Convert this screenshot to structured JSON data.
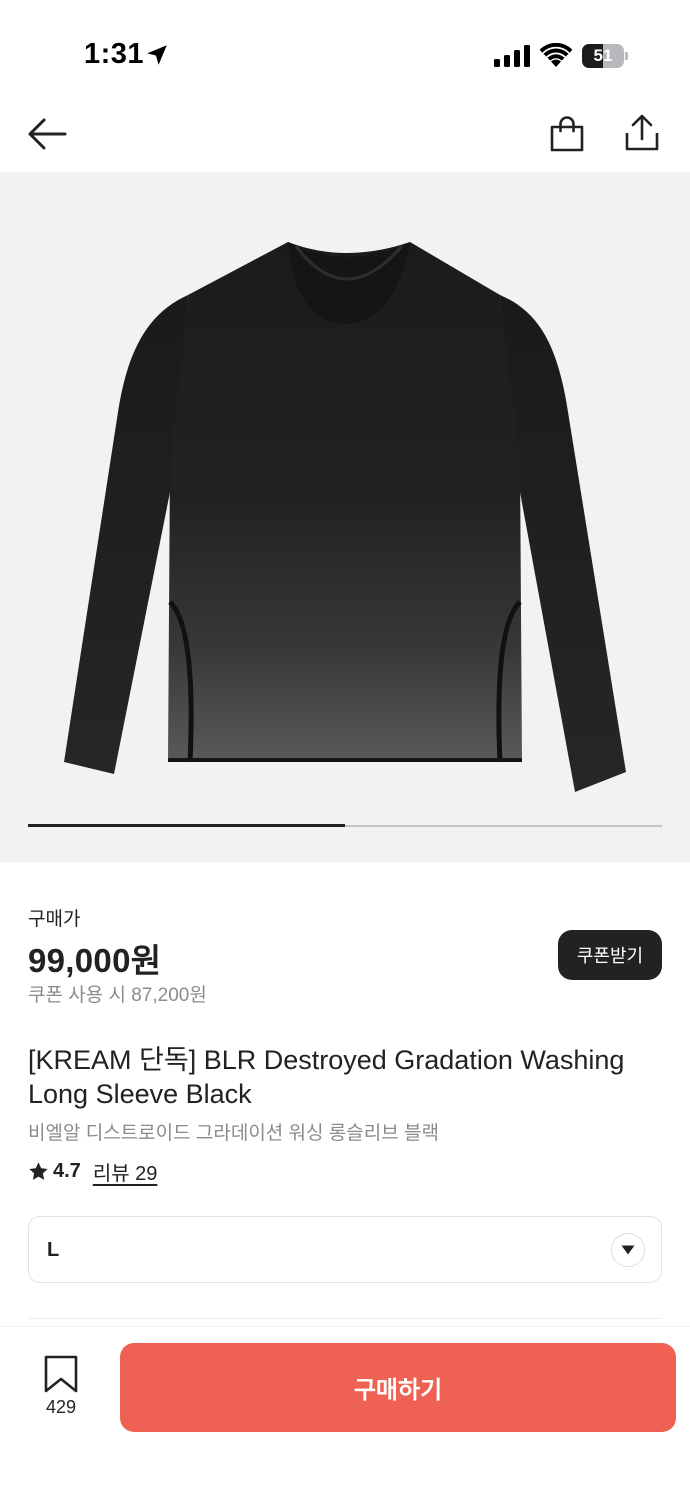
{
  "status_bar": {
    "time": "1:31",
    "battery_level": "51",
    "battery_fraction": 0.51
  },
  "nav": {
    "back_icon": "arrow-left-icon",
    "bag_icon": "shopping-bag-icon",
    "share_icon": "share-icon"
  },
  "gallery": {
    "image_subject": "black long sleeve t-shirt",
    "current_slide_fraction": 0.5
  },
  "product": {
    "price_label": "구매가",
    "price": "99,000원",
    "coupon_price": "쿠폰 사용 시 87,200원",
    "coupon_button_label": "쿠폰받기",
    "title_en": "[KREAM 단독] BLR Destroyed Gradation Washing Long Sleeve Black",
    "title_ko": "비엘알 디스트로이드 그라데이션 워싱 롱슬리브 블랙",
    "rating": "4.7",
    "review_label": "리뷰 29"
  },
  "size_select": {
    "selected": "L"
  },
  "bottom_bar": {
    "wish_count": "429",
    "buy_label": "구매하기"
  },
  "colors": {
    "buy_button": "#ef6253",
    "coupon_button": "#222222",
    "gallery_bg": "#f2f2f2"
  }
}
